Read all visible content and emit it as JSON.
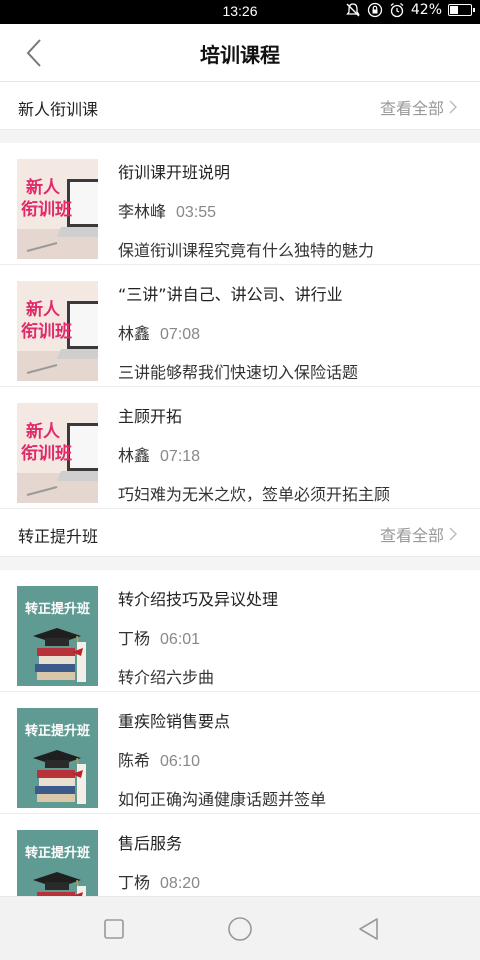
{
  "status": {
    "time": "13:26",
    "battery": "42%",
    "battery_level": 0.42
  },
  "header": {
    "title": "培训课程"
  },
  "sections": [
    {
      "title": "新人衔训课",
      "more": "查看全部",
      "thumb_text": [
        "新人",
        "衔训班"
      ],
      "items": [
        {
          "title": "衔训课开班说明",
          "author": "李林峰",
          "duration": "03:55",
          "desc": "保道衔训课程究竟有什么独特的魅力"
        },
        {
          "title": "“三讲”讲自己、讲公司、讲行业",
          "author": "林鑫",
          "duration": "07:08",
          "desc": "三讲能够帮我们快速切入保险话题"
        },
        {
          "title": "主顾开拓",
          "author": "林鑫",
          "duration": "07:18",
          "desc": "巧妇难为无米之炊，签单必须开拓主顾"
        }
      ]
    },
    {
      "title": "转正提升班",
      "more": "查看全部",
      "thumb_text": [
        "转正提升班"
      ],
      "items": [
        {
          "title": "转介绍技巧及异议处理",
          "author": "丁杨",
          "duration": "06:01",
          "desc": "转介绍六步曲"
        },
        {
          "title": "重疾险销售要点",
          "author": "陈希",
          "duration": "06:10",
          "desc": "如何正确沟通健康话题并签单"
        },
        {
          "title": "售后服务",
          "author": "丁杨",
          "duration": "08:20",
          "desc": ""
        }
      ]
    }
  ],
  "colors": {
    "accent_pink": "#e02a6a",
    "teal_thumb": "#5f9a93",
    "muted": "#999999"
  }
}
